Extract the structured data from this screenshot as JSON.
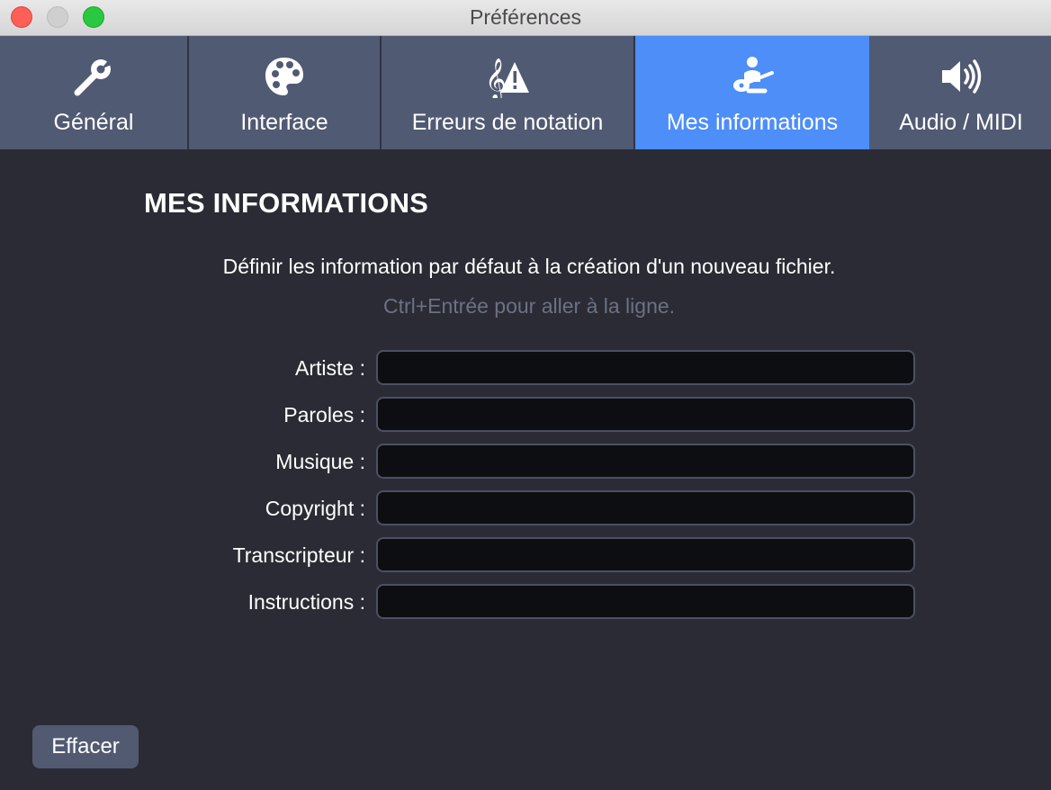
{
  "window": {
    "title": "Préférences"
  },
  "tabs": [
    {
      "id": "general",
      "label": "Général",
      "icon": "wrench-icon",
      "active": false
    },
    {
      "id": "interface",
      "label": "Interface",
      "icon": "palette-icon",
      "active": false
    },
    {
      "id": "notation",
      "label": "Erreurs de notation",
      "icon": "clef-warning-icon",
      "active": false
    },
    {
      "id": "info",
      "label": "Mes informations",
      "icon": "guitarist-icon",
      "active": true
    },
    {
      "id": "audio",
      "label": "Audio / MIDI",
      "icon": "speaker-icon",
      "active": false
    }
  ],
  "main": {
    "heading": "MES INFORMATIONS",
    "description": "Définir les information par défaut à la création d'un nouveau fichier.",
    "hint": "Ctrl+Entrée pour aller à la ligne."
  },
  "fields": [
    {
      "label": "Artiste :",
      "value": ""
    },
    {
      "label": "Paroles :",
      "value": ""
    },
    {
      "label": "Musique :",
      "value": ""
    },
    {
      "label": "Copyright :",
      "value": ""
    },
    {
      "label": "Transcripteur :",
      "value": ""
    },
    {
      "label": "Instructions :",
      "value": ""
    }
  ],
  "buttons": {
    "clear": "Effacer"
  },
  "colors": {
    "toolbar": "#515a73",
    "active_tab": "#4d8ef8",
    "background": "#2a2b34",
    "hint": "#6c7183"
  }
}
